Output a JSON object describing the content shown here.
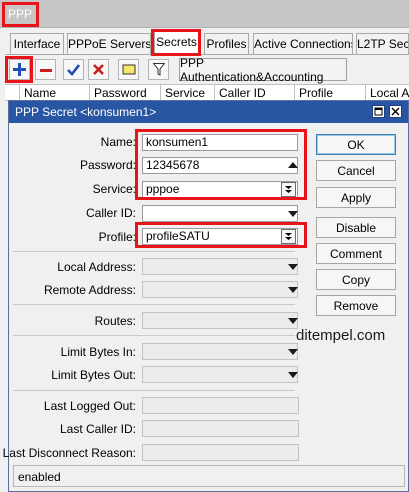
{
  "window": {
    "title": "PPP"
  },
  "tabs": [
    {
      "label": "Interface"
    },
    {
      "label": "PPPoE Servers"
    },
    {
      "label": "Secrets"
    },
    {
      "label": "Profiles"
    },
    {
      "label": "Active Connections"
    },
    {
      "label": "L2TP Sec"
    }
  ],
  "active_tab": "Secrets",
  "toolbar": {
    "add_icon": "plus-icon",
    "remove_icon": "minus-icon",
    "enable_icon": "check-icon",
    "disable_icon": "x-icon",
    "comment_icon": "note-icon",
    "filter_icon": "filter-icon",
    "auth_button_label": "PPP Authentication&Accounting"
  },
  "columns": [
    "Name",
    "Password",
    "Service",
    "Caller ID",
    "Profile",
    "Local Ad"
  ],
  "dialog": {
    "title": "PPP Secret <konsumen1>",
    "fields": {
      "name": {
        "label": "Name:",
        "value": "konsumen1"
      },
      "password": {
        "label": "Password:",
        "value": "12345678"
      },
      "service": {
        "label": "Service:",
        "value": "pppoe"
      },
      "caller_id": {
        "label": "Caller ID:",
        "value": ""
      },
      "profile": {
        "label": "Profile:",
        "value": "profileSATU"
      },
      "local_address": {
        "label": "Local Address:",
        "value": ""
      },
      "remote_address": {
        "label": "Remote Address:",
        "value": ""
      },
      "routes": {
        "label": "Routes:",
        "value": ""
      },
      "limit_bytes_in": {
        "label": "Limit Bytes In:",
        "value": ""
      },
      "limit_bytes_out": {
        "label": "Limit Bytes Out:",
        "value": ""
      },
      "last_logged_out": {
        "label": "Last Logged Out:",
        "value": ""
      },
      "last_caller_id": {
        "label": "Last Caller ID:",
        "value": ""
      },
      "last_disconnect_reason": {
        "label": "Last Disconnect Reason:",
        "value": ""
      }
    },
    "buttons": {
      "ok": "OK",
      "cancel": "Cancel",
      "apply": "Apply",
      "disable": "Disable",
      "comment": "Comment",
      "copy": "Copy",
      "remove": "Remove"
    },
    "status": "enabled"
  },
  "watermark": "ditempel.com",
  "colors": {
    "highlight": "#e8141b",
    "dialog_title_bar": "#2956a3",
    "add_icon": "#1f4fb8",
    "remove_icon": "#c81e1e"
  }
}
